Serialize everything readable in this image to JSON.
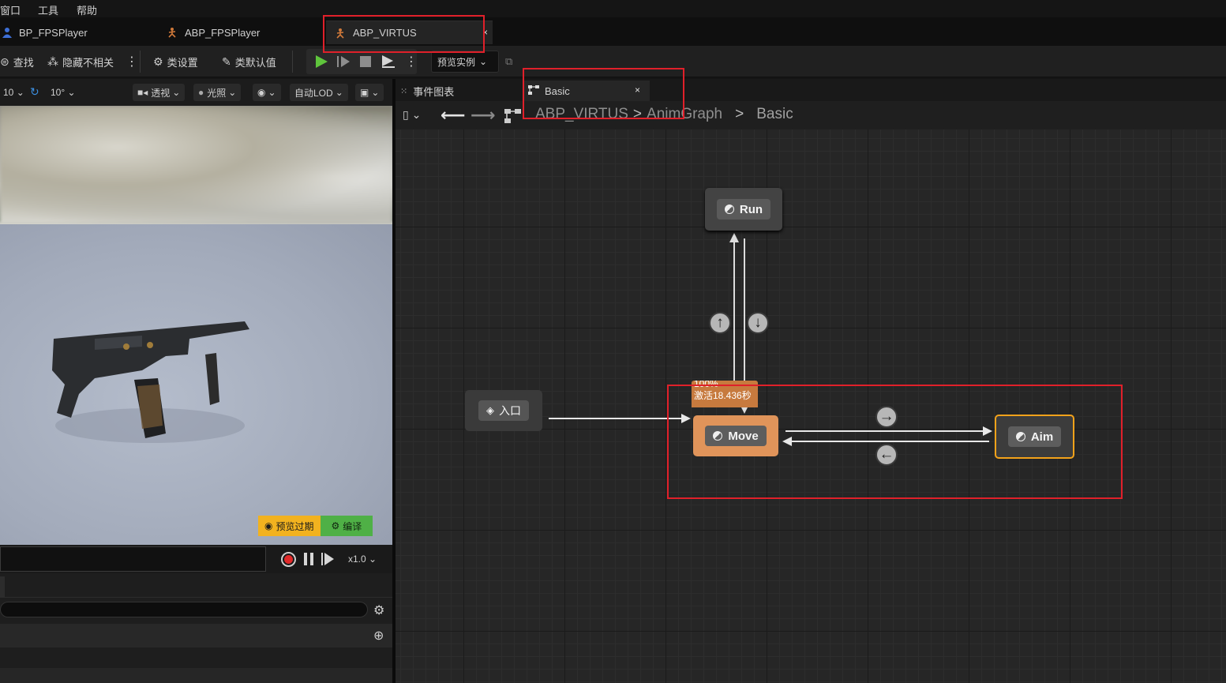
{
  "menu": {
    "window": "窗口",
    "tools": "工具",
    "help": "帮助"
  },
  "doc_tabs": [
    {
      "label": "BP_FPSPlayer",
      "icon": "character-icon"
    },
    {
      "label": "ABP_FPSPlayer",
      "icon": "anim-blueprint-icon"
    },
    {
      "label": "ABP_VIRTUS",
      "icon": "anim-blueprint-icon",
      "active": true,
      "close": "×"
    }
  ],
  "toolbar": {
    "find": "查找",
    "hide_unrelated": "隐藏不相关",
    "class_settings": "类设置",
    "class_defaults": "类默认值",
    "preview_instance": "预览实例"
  },
  "viewport": {
    "fov_left": "10",
    "fov_angle": "10°",
    "perspective": "透视",
    "lighting": "光照",
    "auto_lod": "自动LOD",
    "badge_preview": "预览过期",
    "badge_compile": "编译",
    "playback_speed": "x1.0"
  },
  "graph_tabs": [
    {
      "label": "事件图表",
      "icon": "event-graph-icon"
    },
    {
      "label": "Basic",
      "icon": "state-machine-icon",
      "active": true,
      "close": "×"
    }
  ],
  "breadcrumb": {
    "items": [
      "ABP_VIRTUS",
      "AnimGraph",
      "Basic"
    ],
    "separator": ">"
  },
  "state_machine": {
    "entry_label": "入口",
    "states": [
      {
        "name": "Run",
        "status": "inactive"
      },
      {
        "name": "Move",
        "status": "active"
      },
      {
        "name": "Aim",
        "status": "selected"
      }
    ],
    "active_info": {
      "weight": "100%",
      "active_time": "激活18.436秒"
    }
  },
  "colors": {
    "accent_orange": "#e0945a",
    "selected_border": "#f3a21a",
    "highlight_red": "#e0202a",
    "play_green": "#5fc53c",
    "compile_green": "#4fb046",
    "preview_yellow": "#f2b21f"
  }
}
